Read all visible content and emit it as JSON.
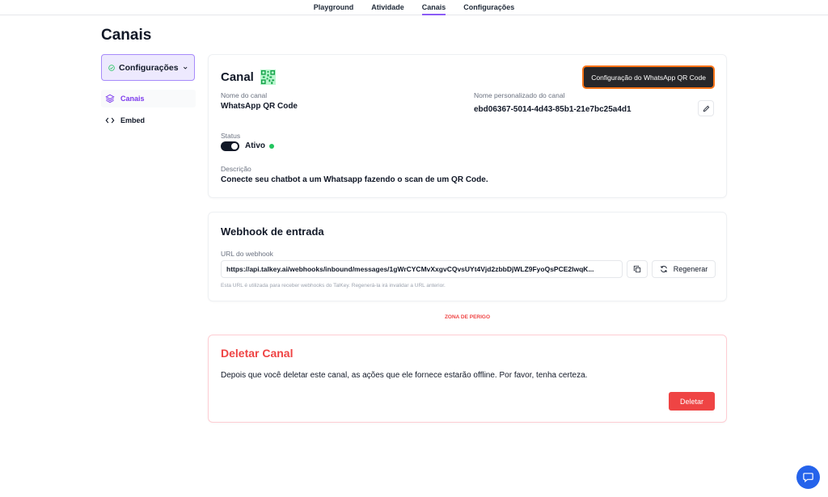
{
  "nav": {
    "tabs": [
      {
        "label": "Playground"
      },
      {
        "label": "Atividade"
      },
      {
        "label": "Canais"
      },
      {
        "label": "Configurações"
      }
    ],
    "active_tab": "Canais"
  },
  "page": {
    "title": "Canais"
  },
  "sidebar": {
    "dropdown_label": "Configurações",
    "items": [
      {
        "label": "Canais",
        "icon": "layers-icon",
        "active": true
      },
      {
        "label": "Embed",
        "icon": "code-icon",
        "active": false
      }
    ]
  },
  "canal": {
    "title": "Canal",
    "config_button": "Configuração do WhatsApp QR Code",
    "name_label": "Nome do canal",
    "name_value": "WhatsApp QR Code",
    "custom_name_label": "Nome personalizado do canal",
    "custom_name_value": "ebd06367-5014-4d43-85b1-21e7bc25a4d1",
    "status_label": "Status",
    "status_value": "Ativo",
    "description_label": "Descrição",
    "description_value": "Conecte seu chatbot a um Whatsapp fazendo o scan de um QR Code."
  },
  "webhook": {
    "title": "Webhook de entrada",
    "url_label": "URL do webhook",
    "url_value": "https://api.talkey.ai/webhooks/inbound/messages/1gWrCYCMvXxgvCQvsUYt4Vjd2zbbDjWLZ9FyoQsPCE2lwqK...",
    "regen_label": "Regenerar",
    "helper": "Esta URL é utilizada para receber webhooks do TalKey. Regenerá-la irá invalidar a URL anterior."
  },
  "danger": {
    "zone_label": "ZONA DE PERIGO",
    "title": "Deletar Canal",
    "text": "Depois que você deletar este canal, as ações que ele fornece estarão offline. Por favor, tenha certeza.",
    "button": "Deletar"
  },
  "colors": {
    "accent": "#8b5cf6",
    "danger": "#ef4444",
    "status_ok": "#22c55e",
    "fab": "#2563eb"
  }
}
